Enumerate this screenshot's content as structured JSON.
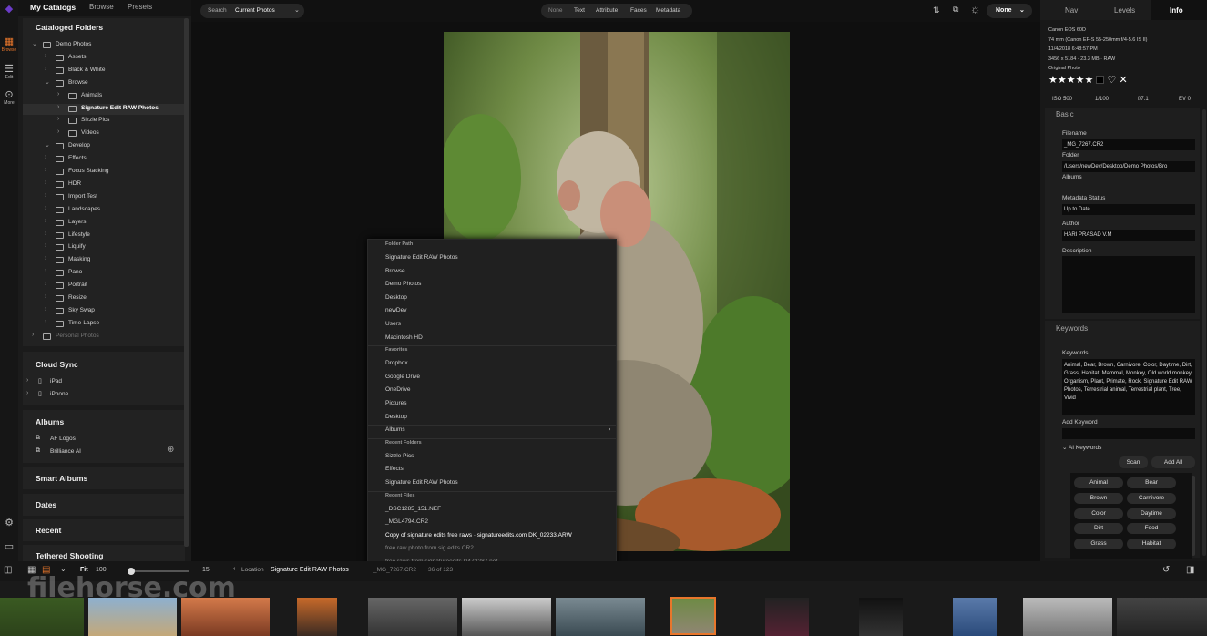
{
  "left_rail": {
    "items": [
      {
        "label": "Browse",
        "icon": "grid-icon"
      },
      {
        "label": "Edit",
        "icon": "sliders-icon"
      },
      {
        "label": "More",
        "icon": "more-icon"
      }
    ]
  },
  "catalog_tabs": [
    "My Catalogs",
    "Browse",
    "Presets"
  ],
  "cataloged_folders": {
    "title": "Cataloged Folders",
    "rows": [
      {
        "label": "Demo Photos",
        "level": 0,
        "open": true
      },
      {
        "label": "Assets",
        "level": 1
      },
      {
        "label": "Black & White",
        "level": 1
      },
      {
        "label": "Browse",
        "level": 1,
        "open": true
      },
      {
        "label": "Animals",
        "level": 2
      },
      {
        "label": "Signature Edit RAW Photos",
        "level": 2,
        "selected": true
      },
      {
        "label": "Sizzle Pics",
        "level": 2
      },
      {
        "label": "Videos",
        "level": 2
      },
      {
        "label": "Develop",
        "level": 1,
        "open": true
      },
      {
        "label": "Effects",
        "level": 1
      },
      {
        "label": "Focus Stacking",
        "level": 1
      },
      {
        "label": "HDR",
        "level": 1
      },
      {
        "label": "Import Test",
        "level": 1
      },
      {
        "label": "Landscapes",
        "level": 1
      },
      {
        "label": "Layers",
        "level": 1
      },
      {
        "label": "Lifestyle",
        "level": 1
      },
      {
        "label": "Liquify",
        "level": 1
      },
      {
        "label": "Masking",
        "level": 1
      },
      {
        "label": "Pano",
        "level": 1
      },
      {
        "label": "Portrait",
        "level": 1
      },
      {
        "label": "Resize",
        "level": 1
      },
      {
        "label": "Sky Swap",
        "level": 1
      },
      {
        "label": "Time-Lapse",
        "level": 1
      },
      {
        "label": "Personal Photos",
        "level": 0,
        "dim": true
      }
    ]
  },
  "cloud_sync": {
    "title": "Cloud Sync",
    "items": [
      "iPad",
      "iPhone"
    ]
  },
  "albums": {
    "title": "Albums",
    "items": [
      "AF Logos",
      "Brilliance AI"
    ]
  },
  "smart_albums": "Smart Albums",
  "dates": "Dates",
  "recent": "Recent",
  "tethered": "Tethered Shooting",
  "topbar": {
    "search_label": "Search",
    "search_value": "Current Photos",
    "filters": [
      "None",
      "Text",
      "Attribute",
      "Faces",
      "Metadata"
    ],
    "none_label": "None"
  },
  "context_menu": {
    "folder_path_header": "Folder Path",
    "folder_path": [
      "Signature Edit RAW Photos",
      "Browse",
      "Demo Photos",
      "Desktop",
      "newDev",
      "Users",
      "Macintosh HD"
    ],
    "favorites_header": "Favorites",
    "favorites": [
      "Dropbox",
      "Google Drive",
      "OneDrive",
      "Pictures",
      "Desktop"
    ],
    "albums_label": "Albums",
    "recent_folders_header": "Recent Folders",
    "recent_folders": [
      "Sizzle Pics",
      "Effects",
      "Signature Edit RAW Photos"
    ],
    "recent_files_header": "Recent Files",
    "recent_files": [
      "_DSC1285_151.NEF",
      "_MGL4794.CR2",
      "Copy of signature edits free raws · signatureedits.com DK_02233.ARW",
      "free raw photo from sig edits.CR2",
      "free raws from signatureedits D4Z2287.nef"
    ]
  },
  "right_tabs": [
    "Nav",
    "Levels",
    "Info"
  ],
  "info": {
    "camera": "Canon EOS 60D",
    "lens": "74 mm (Canon EF-S 55-250mm f/4-5.6 IS II)",
    "date": "11/4/2018 6:48:57 PM",
    "size": "3456 x 5184 · 23.3 MB · RAW",
    "photo_kind": "Original Photo",
    "rating": 5,
    "iso": "ISO 500",
    "shutter": "1/100",
    "aperture": "f/7.1",
    "ev": "EV 0"
  },
  "basic": {
    "title": "Basic",
    "filename_label": "Filename",
    "filename": "_MG_7267.CR2",
    "folder_label": "Folder",
    "folder": "/Users/newDev/Desktop/Demo Photos/Bro",
    "albums_label": "Albums",
    "metadata_status_label": "Metadata Status",
    "metadata_status": "Up to Date",
    "author_label": "Author",
    "author": "HARI PRASAD V.M",
    "description_label": "Description"
  },
  "keywords": {
    "section": "Keywords",
    "label": "Keywords",
    "value": "Animal, Bear, Brown, Carnivore, Color, Daytime, Dirt, Grass, Habitat, Mammal, Monkey, Old world monkey, Organism, Plant, Primate, Rock, Signature Edit RAW Photos, Terrestrial animal, Terrestrial plant, Tree, Vivid",
    "add_label": "Add Keyword",
    "ai_label": "AI Keywords",
    "scan": "Scan",
    "add_all": "Add All",
    "chips": [
      "Animal",
      "Bear",
      "Brown",
      "Carnivore",
      "Color",
      "Daytime",
      "Dirt",
      "Food",
      "Grass",
      "Habitat"
    ]
  },
  "bottombar": {
    "fit": "Fit",
    "zoom": "100",
    "zoom_fraction": 0.0,
    "count": "15",
    "location_label": "Location",
    "location": "Signature Edit RAW Photos",
    "file_info": "_MG_7267.CR2",
    "position": "36 of 123"
  },
  "watermark": "filehorse.com",
  "colors": {
    "accent": "#e8762b",
    "panel": "#1b1b1b",
    "bg": "#111111"
  }
}
